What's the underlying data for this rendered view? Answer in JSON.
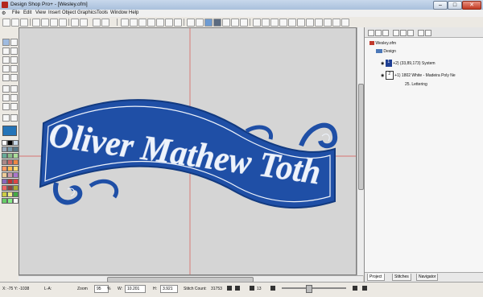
{
  "window": {
    "title": "Design Shop Pro+ - [Wesley.ofm]",
    "controls": [
      "minimize-icon",
      "maximize-icon",
      "close-icon"
    ]
  },
  "menu": [
    "File",
    "Edit",
    "View",
    "Insert",
    "Object",
    "Graphics",
    "Tools",
    "Window",
    "Help"
  ],
  "design": {
    "lettering": "Oliver Mathew Toth",
    "ribbon_color": "#1f4fa6",
    "text_color": "#eef3fb",
    "guide_color": "#d9534f"
  },
  "tree": {
    "file": "Wesley.ofm",
    "design": "Design",
    "node_system": "+2) (33,89,173) System",
    "node_system_num": "1",
    "node_thread": "+1) 1802 White - Madeira Poly Ne",
    "node_thread_num": "2",
    "node_lettering": "25. Lettering"
  },
  "tabs": [
    "Project",
    "Stitches",
    "Navigator"
  ],
  "status": {
    "coords": "X: -75  Y: -1038",
    "la": "L-A:",
    "zoom_label": "Zoom",
    "zoom_value": "95",
    "zoom_unit": "%",
    "w_label": "W:",
    "w_value": "10.201",
    "h_label": "H:",
    "h_value": "3.921",
    "stitch_label": "Stitch Count:",
    "stitch_value": "31753",
    "frame_value": "13"
  },
  "palette": [
    "#ffffff",
    "#000000",
    "#c8d8e8",
    "#9ab",
    "#79a",
    "#578",
    "#6a9",
    "#8b8",
    "#ad9",
    "#a88",
    "#c66",
    "#e84",
    "#f96",
    "#fb5",
    "#fd7",
    "#ec9",
    "#c9a",
    "#a7c",
    "#86b",
    "#b33",
    "#d44",
    "#e66",
    "#844",
    "#aa3",
    "#cc4",
    "#ee8",
    "#4a4",
    "#6c6",
    "#8e8",
    "#fff"
  ]
}
